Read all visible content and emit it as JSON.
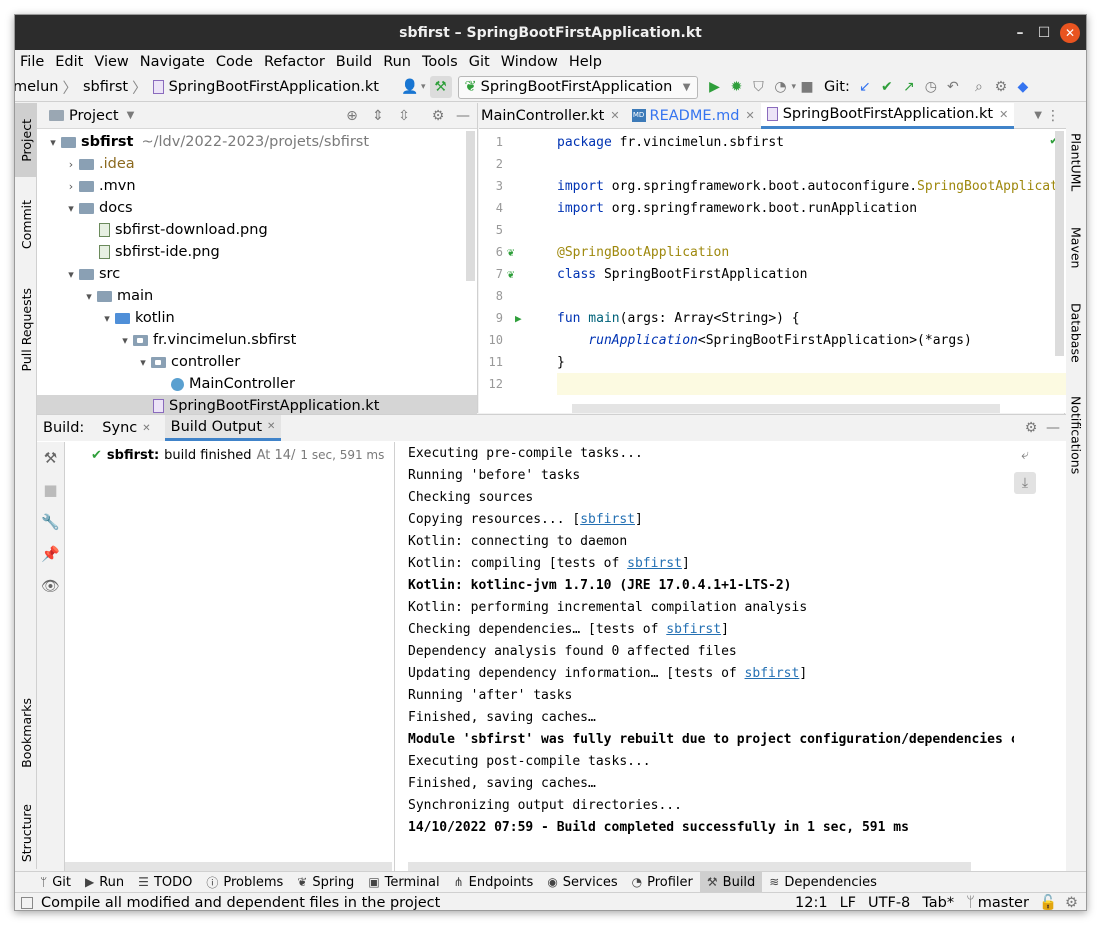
{
  "window": {
    "title": "sbfirst – SpringBootFirstApplication.kt",
    "min_icon": "minimize-icon",
    "max_icon": "maximize-icon",
    "close_icon": "close-icon"
  },
  "menu": [
    "File",
    "Edit",
    "View",
    "Navigate",
    "Code",
    "Refactor",
    "Build",
    "Run",
    "Tools",
    "Git",
    "Window",
    "Help"
  ],
  "nav": {
    "crumbs": [
      "melun",
      "sbfirst",
      "SpringBootFirstApplication.kt"
    ],
    "run_config": "SpringBootFirstApplication",
    "git_label": "Git:"
  },
  "left_strip": {
    "top": [
      "Project",
      "Commit",
      "Pull Requests"
    ],
    "bottom": [
      "Bookmarks",
      "Structure"
    ]
  },
  "right_strip": [
    "PlantUML",
    "Maven",
    "Database",
    "Notifications"
  ],
  "project": {
    "header": "Project",
    "tree": [
      {
        "label": "sbfirst",
        "path": "~/ldv/2022-2023/projets/sbfirst"
      },
      {
        "label": ".idea"
      },
      {
        "label": ".mvn"
      },
      {
        "label": "docs"
      },
      {
        "label": "sbfirst-download.png"
      },
      {
        "label": "sbfirst-ide.png"
      },
      {
        "label": "src"
      },
      {
        "label": "main"
      },
      {
        "label": "kotlin"
      },
      {
        "label": "fr.vincimelun.sbfirst"
      },
      {
        "label": "controller"
      },
      {
        "label": "MainController"
      },
      {
        "label": "SpringBootFirstApplication.kt"
      }
    ]
  },
  "editor": {
    "tabs": [
      "MainController.kt",
      "README.md",
      "SpringBootFirstApplication.kt"
    ],
    "line_numbers": [
      "1",
      "2",
      "3",
      "4",
      "5",
      "6",
      "7",
      "8",
      "9",
      "10",
      "11",
      "12"
    ],
    "code": {
      "l1_kw": "package",
      "l1_rest": " fr.vincimelun.sbfirst",
      "l3_kw": "import",
      "l3_rest": " org.springframework.boot.autoconfigure.",
      "l3_ann": "SpringBootApplicat",
      "l4_kw": "import",
      "l4_rest": " org.springframework.boot.runApplication",
      "l6_ann": "@SpringBootApplication",
      "l7_kw": "class",
      "l7_rest": " SpringBootFirstApplication",
      "l9_kw": "fun",
      "l9_fn": " main",
      "l9_rest": "(args: Array<String>) {",
      "l10_it": "runApplication",
      "l10_rest": "<SpringBootFirstApplication>(*args)",
      "l11": "}"
    }
  },
  "build": {
    "label": "Build:",
    "tabs": [
      "Sync",
      "Build Output"
    ],
    "tree_item": {
      "name": "sbfirst:",
      "status": "build finished",
      "time": "At 14/",
      "duration": "1 sec, 591 ms"
    },
    "output": [
      {
        "text": "Executing pre-compile tasks...",
        "bold": false
      },
      {
        "text": "Running 'before' tasks",
        "bold": false
      },
      {
        "text": "Checking sources",
        "bold": false
      },
      {
        "pre": "Copying resources... [",
        "link": "sbfirst",
        "post": "]"
      },
      {
        "text": "Kotlin: connecting to daemon",
        "bold": false
      },
      {
        "pre": "Kotlin: compiling [tests of ",
        "link": "sbfirst",
        "post": "]"
      },
      {
        "text": "Kotlin: kotlinc-jvm 1.7.10 (JRE 17.0.4.1+1-LTS-2)",
        "bold": true
      },
      {
        "text": "Kotlin: performing incremental compilation analysis",
        "bold": false
      },
      {
        "pre": "Checking dependencies… [tests of ",
        "link": "sbfirst",
        "post": "]"
      },
      {
        "text": "Dependency analysis found 0 affected files",
        "bold": false
      },
      {
        "pre": "Updating dependency information… [tests of ",
        "link": "sbfirst",
        "post": "]"
      },
      {
        "text": "Running 'after' tasks",
        "bold": false
      },
      {
        "text": "Finished, saving caches…",
        "bold": false
      },
      {
        "text": "Module 'sbfirst' was fully rebuilt due to project configuration/dependencies ch",
        "bold": true
      },
      {
        "text": "Executing post-compile tasks...",
        "bold": false
      },
      {
        "text": "Finished, saving caches…",
        "bold": false
      },
      {
        "text": "Synchronizing output directories...",
        "bold": false
      },
      {
        "text": "14/10/2022 07:59 - Build completed successfully in 1 sec, 591 ms",
        "bold": true
      }
    ]
  },
  "toolwindows": [
    "Git",
    "Run",
    "TODO",
    "Problems",
    "Spring",
    "Terminal",
    "Endpoints",
    "Services",
    "Profiler",
    "Build",
    "Dependencies"
  ],
  "status": {
    "message": "Compile all modified and dependent files in the project",
    "position": "12:1",
    "line_sep": "LF",
    "encoding": "UTF-8",
    "indent": "Tab*",
    "branch": "master"
  },
  "colors": {
    "accent": "#4083c9",
    "success": "#2f9f3b",
    "link": "#2470b3",
    "close_button": "#e95420"
  }
}
